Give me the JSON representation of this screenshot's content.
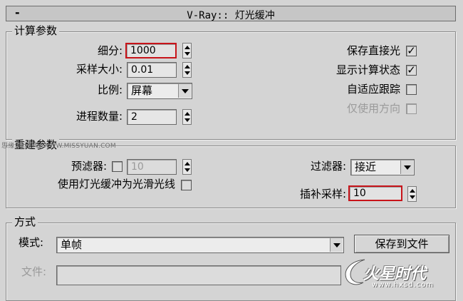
{
  "header": {
    "toggle": "-",
    "title": "V-Ray:: 灯光缓冲"
  },
  "calc": {
    "title": "计算参数",
    "subdivs": {
      "label": "细分:",
      "value": "1000"
    },
    "sample_size": {
      "label": "采样大小:",
      "value": "0.01"
    },
    "scale": {
      "label": "比例:",
      "value": "屏幕"
    },
    "passes": {
      "label": "进程数量:",
      "value": "2"
    },
    "store_direct": {
      "label": "保存直接光",
      "checked": "✓"
    },
    "show_calc": {
      "label": "显示计算状态",
      "checked": "✓"
    },
    "adaptive": {
      "label": "自适应跟踪",
      "checked": ""
    },
    "use_dirs": {
      "label": "仅使用方向",
      "checked": ""
    }
  },
  "rebuild": {
    "title": "重建参数",
    "prefilter": {
      "label": "预滤器:",
      "value": "10"
    },
    "use_for_glossy": {
      "label": "使用灯光缓冲为光滑光线"
    },
    "filter": {
      "label": "过滤器:",
      "value": "接近"
    },
    "interp": {
      "label": "插补采样:",
      "value": "10"
    }
  },
  "mode": {
    "title": "方式",
    "mode_label": "模式:",
    "mode_value": "单帧",
    "save_button": "保存到文件",
    "file_label": "文件:"
  },
  "watermark": "思缘设计论坛 WWW.MISSYUAN.COM",
  "logo": {
    "main": "火星时代",
    "sub": "www.hxsd.com"
  }
}
